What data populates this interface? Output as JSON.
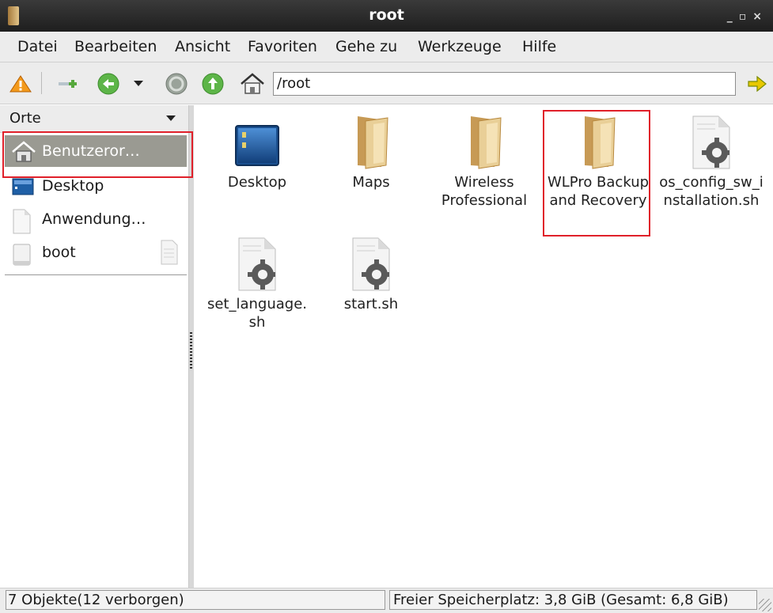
{
  "window": {
    "title": "root"
  },
  "menu": {
    "items": [
      {
        "label": "Datei"
      },
      {
        "label": "Bearbeiten"
      },
      {
        "label": "Ansicht"
      },
      {
        "label": "Favoriten"
      },
      {
        "label": "Gehe zu"
      },
      {
        "label": "Werkzeuge"
      },
      {
        "label": "Hilfe"
      }
    ]
  },
  "toolbar": {
    "address": "/root",
    "icons": [
      "warning-icon",
      "new-tab-icon",
      "back-icon",
      "dropdown-icon",
      "forward-icon",
      "up-icon",
      "home-icon",
      "go-icon"
    ]
  },
  "sidebar": {
    "header": "Orte",
    "items": [
      {
        "label": "Benutzeror…",
        "icon": "home-icon"
      },
      {
        "label": "Desktop",
        "icon": "desktop-icon"
      },
      {
        "label": "Anwendung…",
        "icon": "file-icon"
      },
      {
        "label": "boot",
        "icon": "drive-icon"
      }
    ]
  },
  "files": [
    {
      "label": "Desktop",
      "icon": "desktop-folder-icon"
    },
    {
      "label": "Maps",
      "icon": "folder-icon"
    },
    {
      "label": "Wireless Professional",
      "icon": "folder-icon"
    },
    {
      "label": "WLPro Backup and Recovery",
      "icon": "folder-icon"
    },
    {
      "label": "os_config_sw_installation.sh",
      "icon": "script-icon"
    },
    {
      "label": "set_language.sh",
      "icon": "script-icon"
    },
    {
      "label": "start.sh",
      "icon": "script-icon"
    }
  ],
  "status": {
    "left": "7 Objekte(12 verborgen)",
    "right": "Freier Speicherplatz: 3,8 GiB (Gesamt: 6,8 GiB)"
  },
  "colors": {
    "highlight": "#e0202a",
    "selection": "#9a9a92"
  }
}
